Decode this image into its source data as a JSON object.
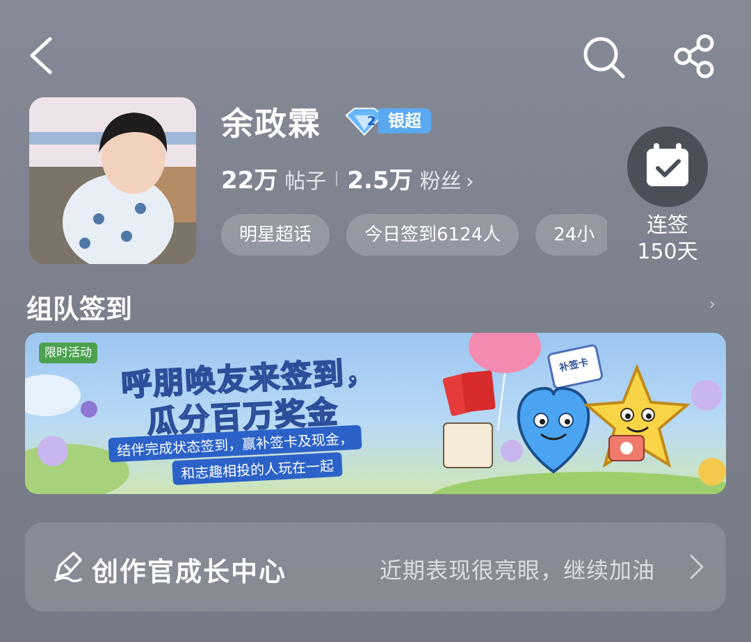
{
  "profile": {
    "name": "余政霖",
    "badge_level": "2",
    "badge_text": "银超",
    "posts_count": "22万",
    "posts_label": "帖子",
    "fans_count": "2.5万",
    "fans_label": "粉丝"
  },
  "chips": [
    "明星超话",
    "今日签到6124人",
    "24小"
  ],
  "checkin": {
    "line1": "连签",
    "line2": "150天"
  },
  "team_checkin": {
    "title": "组队签到",
    "banner": {
      "tag": "限时活动",
      "headline1": "呼朋唤友来签到，",
      "headline2": "瓜分百万奖金",
      "line1": "结伴完成状态签到，赢补签卡及现金，",
      "line2": "和志趣相投的人玩在一起",
      "card_label": "补签卡"
    }
  },
  "creator": {
    "title": "创作官成长中心",
    "subtitle": "近期表现很亮眼，继续加油"
  },
  "icons": [
    "back-icon",
    "search-icon",
    "share-icon",
    "calendar-check-icon",
    "creator-quill-icon",
    "chevron-right-icon"
  ]
}
